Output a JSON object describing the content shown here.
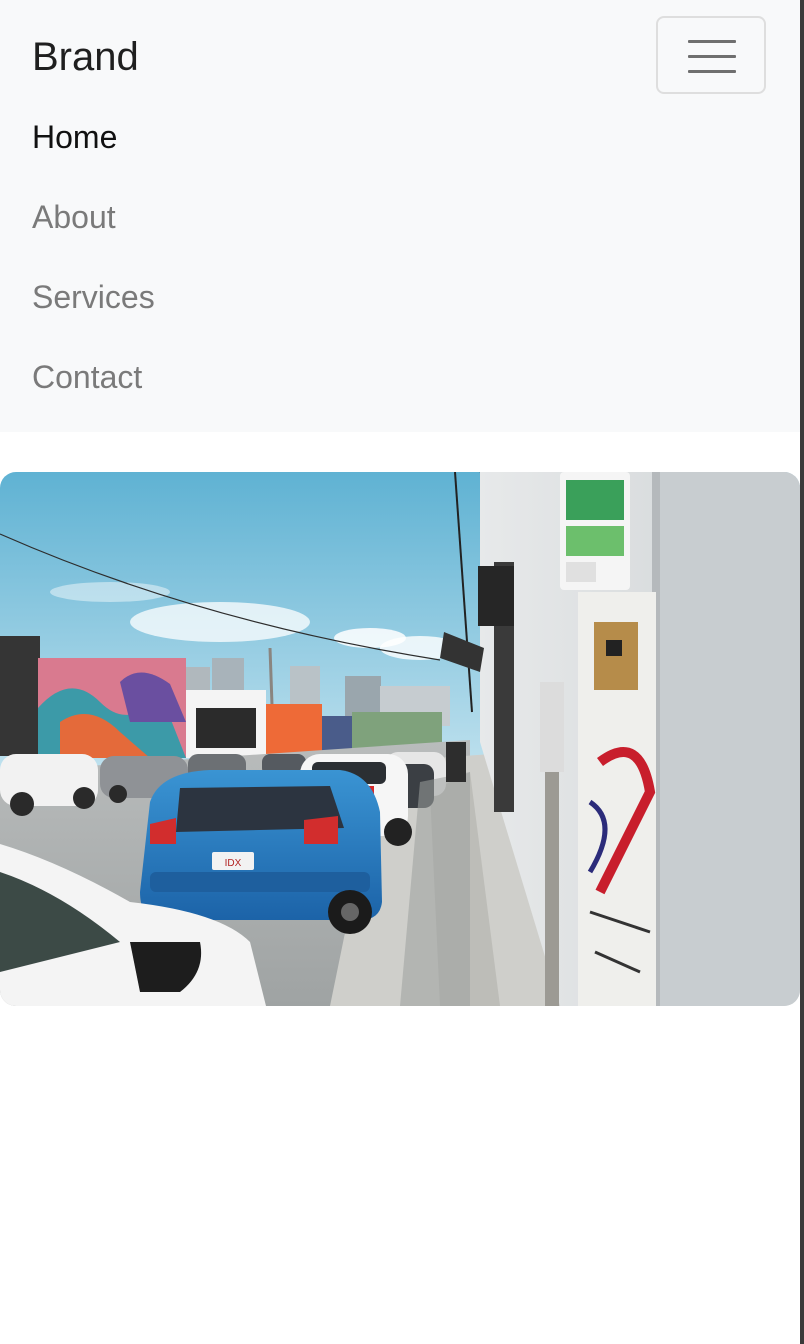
{
  "navbar": {
    "brand": "Brand",
    "toggler_icon": "hamburger-menu-icon",
    "links": [
      {
        "label": "Home",
        "active": true
      },
      {
        "label": "About",
        "active": false
      },
      {
        "label": "Services",
        "active": false
      },
      {
        "label": "Contact",
        "active": false
      }
    ]
  },
  "colors": {
    "navbar_background": "#f8f9fa",
    "active_link": "#111111",
    "inactive_link": "#7a7a7a"
  },
  "image": {
    "subject": "street-scene-photo"
  }
}
